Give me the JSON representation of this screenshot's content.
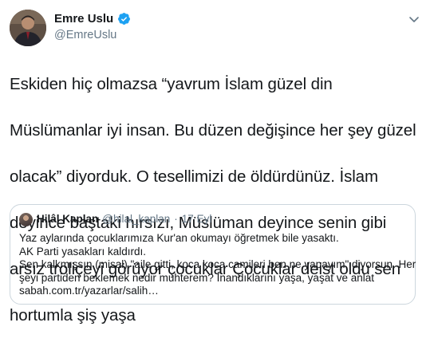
{
  "tweet": {
    "display_name": "Emre Uslu",
    "handle": "@EmreUslu",
    "verified_icon": "verified-badge-icon",
    "menu_icon": "chevron-down-icon",
    "brand_color": "#1da1f2",
    "text_lines": [
      "Eskiden hiç olmazsa “yavrum İslam güzel din",
      "Müslümanlar iyi insan. Bu düzen değişince her şey güzel",
      "olacak” diyorduk. O tesellimizi de öldürdünüz. İslam",
      "deyince baştaki hırsızı, Müslüman deyince senin gibi",
      "arsız troliçeyi görüyor çocuklar Çocuklar deist oldu sen",
      "hortumla şiş yaşa"
    ]
  },
  "quoted_tweet": {
    "display_name": "Hilâl Kaplan",
    "handle": "@hilal_kaplan",
    "separator": "·",
    "date": "17 Eyl",
    "text_lines": [
      "Yaz aylarında çocuklarımıza Kur'an okumayı öğretmek bile yasaktı.",
      "AK Parti yasakları kaldırdı.",
      "Sen kalkmışsın (misal) \"aile gitti, koca koca camileri ben ne yapayım\" diyorsun. Her",
      "şeyi partiden beklemek nedir muhterem? İnandıklarını yaşa, yaşat ve anlat",
      "sabah.com.tr/yazarlar/salih…"
    ]
  }
}
